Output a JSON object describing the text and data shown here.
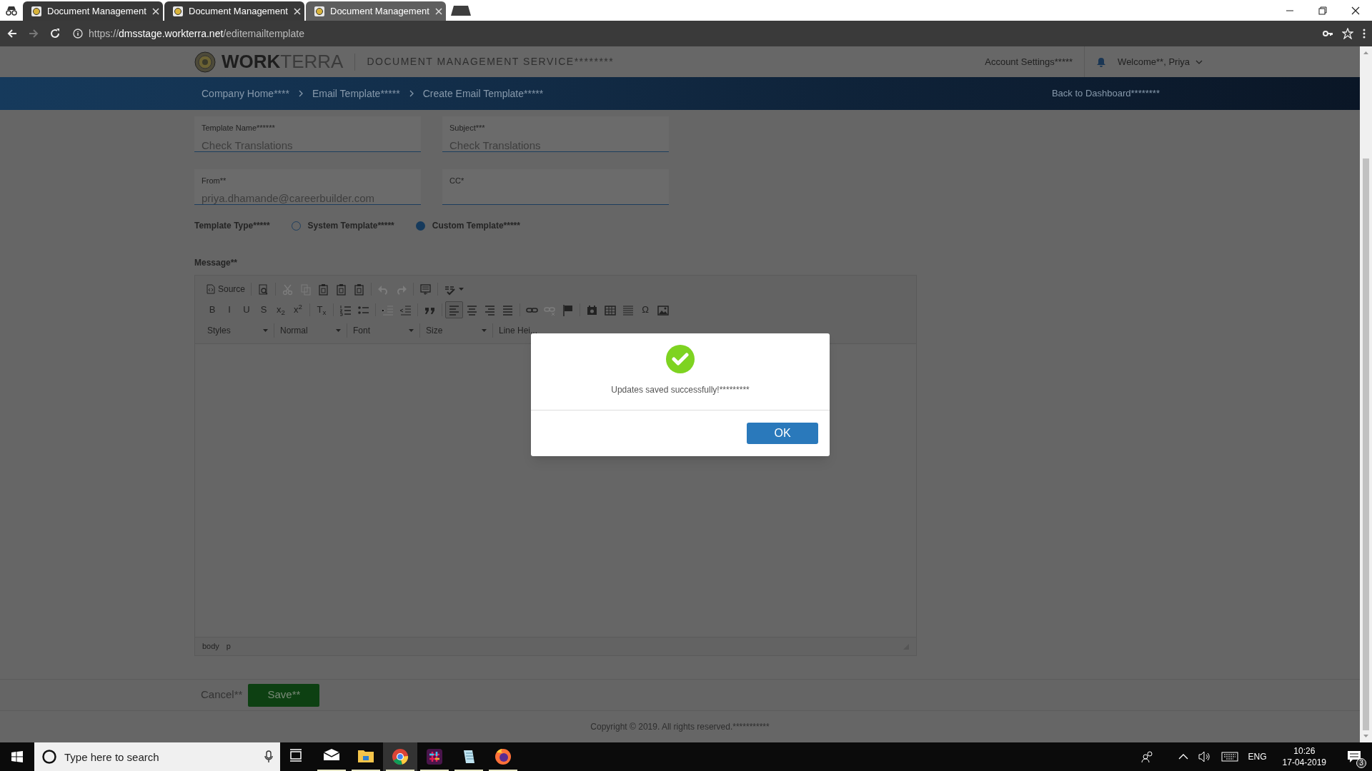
{
  "browser": {
    "tabs": [
      {
        "title": "Document Management",
        "selected": false
      },
      {
        "title": "Document Management",
        "selected": false
      },
      {
        "title": "Document Management",
        "selected": true
      }
    ],
    "url": {
      "scheme": "https://",
      "host": "dmsstage.workterra.net",
      "path": "/editemailtemplate"
    }
  },
  "header": {
    "logo_bold": "WORK",
    "logo_light": "TERRA",
    "service": "DOCUMENT MANAGEMENT SERVICE********",
    "account_settings": "Account Settings*****",
    "welcome": "Welcome**, Priya"
  },
  "breadcrumbs": [
    "Company Home****",
    "Email Template*****",
    "Create Email Template*****"
  ],
  "back_link": "Back to Dashboard********",
  "fields": [
    {
      "label": "Template Name******",
      "value": "Check Translations"
    },
    {
      "label": "Subject***",
      "value": "Check Translations"
    },
    {
      "label": "From**",
      "value": "priya.dhamande@careerbuilder.com"
    },
    {
      "label": "CC*"
    }
  ],
  "template_type": {
    "label": "Template Type*****",
    "options": [
      {
        "label": "System Template*****",
        "selected": false
      },
      {
        "label": "Custom Template*****",
        "selected": true
      }
    ]
  },
  "message_label": "Message**",
  "editor": {
    "toolbar_rows": [
      [
        {
          "kind": "source",
          "label": "Source",
          "disabled": false
        },
        {
          "kind": "sep"
        },
        {
          "kind": "preview",
          "disabled": false
        },
        {
          "kind": "sep"
        },
        {
          "kind": "cut",
          "disabled": true
        },
        {
          "kind": "copy",
          "disabled": true
        },
        {
          "kind": "paste",
          "disabled": false
        },
        {
          "kind": "paste",
          "disabled": false
        },
        {
          "kind": "paste",
          "disabled": false
        },
        {
          "kind": "sep"
        },
        {
          "kind": "undo",
          "disabled": true
        },
        {
          "kind": "redo",
          "disabled": true
        },
        {
          "kind": "sep"
        },
        {
          "kind": "template",
          "disabled": false
        },
        {
          "kind": "sep"
        },
        {
          "kind": "spell",
          "disabled": false
        }
      ],
      [
        {
          "kind": "bold",
          "label": "B",
          "disabled": false,
          "on": false
        },
        {
          "kind": "italic",
          "label": "I",
          "disabled": false,
          "on": false
        },
        {
          "kind": "underline",
          "label": "U",
          "disabled": false,
          "on": false
        },
        {
          "kind": "strike",
          "label": "S",
          "disabled": false,
          "on": false
        },
        {
          "kind": "subscript",
          "label": "x$_{2}$",
          "disabled": false,
          "on": false
        },
        {
          "kind": "superscript",
          "label": "x$^{2}$",
          "disabled": false,
          "on": false
        },
        {
          "kind": "sep"
        },
        {
          "kind": "removeformat",
          "label": "T$_{x}$",
          "disabled": false,
          "on": false
        },
        {
          "kind": "sep"
        },
        {
          "kind": "numlist",
          "disabled": false,
          "on": false
        },
        {
          "kind": "bullist",
          "disabled": false,
          "on": false
        },
        {
          "kind": "sep"
        },
        {
          "kind": "outdent",
          "disabled": true,
          "on": false
        },
        {
          "kind": "indent",
          "disabled": false,
          "on": false
        },
        {
          "kind": "sep"
        },
        {
          "kind": "quote",
          "disabled": false,
          "on": false
        },
        {
          "kind": "sep"
        },
        {
          "kind": "alignleft",
          "disabled": false,
          "on": true
        },
        {
          "kind": "aligncenter",
          "disabled": false,
          "on": false
        },
        {
          "kind": "alignright",
          "disabled": false,
          "on": false
        },
        {
          "kind": "justify",
          "disabled": false,
          "on": false
        },
        {
          "kind": "sep"
        },
        {
          "kind": "link",
          "disabled": false,
          "on": false
        },
        {
          "kind": "unlink",
          "disabled": true,
          "on": false
        },
        {
          "kind": "flag",
          "disabled": false,
          "on": false
        },
        {
          "kind": "sep"
        },
        {
          "kind": "media",
          "disabled": false,
          "on": false
        },
        {
          "kind": "table",
          "disabled": false,
          "on": false
        },
        {
          "kind": "hrule",
          "disabled": false,
          "on": false
        },
        {
          "kind": "specialchar",
          "label": "Ω",
          "disabled": false,
          "on": false
        },
        {
          "kind": "image",
          "disabled": false,
          "on": false
        }
      ]
    ],
    "dropdowns": [
      "Styles",
      "Normal",
      "Font",
      "Size",
      "Line Hei..."
    ],
    "path": [
      "body",
      "p"
    ]
  },
  "actions": {
    "cancel": "Cancel**",
    "save": "Save**"
  },
  "copyright": "Copyright © 2019. All rights reserved.***********",
  "dialog": {
    "message": "Updates saved successfully!*********",
    "ok": "OK"
  },
  "taskbar": {
    "search_placeholder": "Type here to search",
    "apps": [
      {
        "kind": "taskview",
        "selected": false
      },
      {
        "kind": "mail",
        "selected": false
      },
      {
        "kind": "folder",
        "selected": false
      },
      {
        "kind": "chrome",
        "selected": true
      },
      {
        "kind": "slack",
        "selected": false
      },
      {
        "kind": "notepad",
        "selected": false
      },
      {
        "kind": "firefox",
        "selected": false
      }
    ],
    "language": "ENG",
    "time": "10:26",
    "date": "17-04-2019",
    "notifications": "3"
  }
}
